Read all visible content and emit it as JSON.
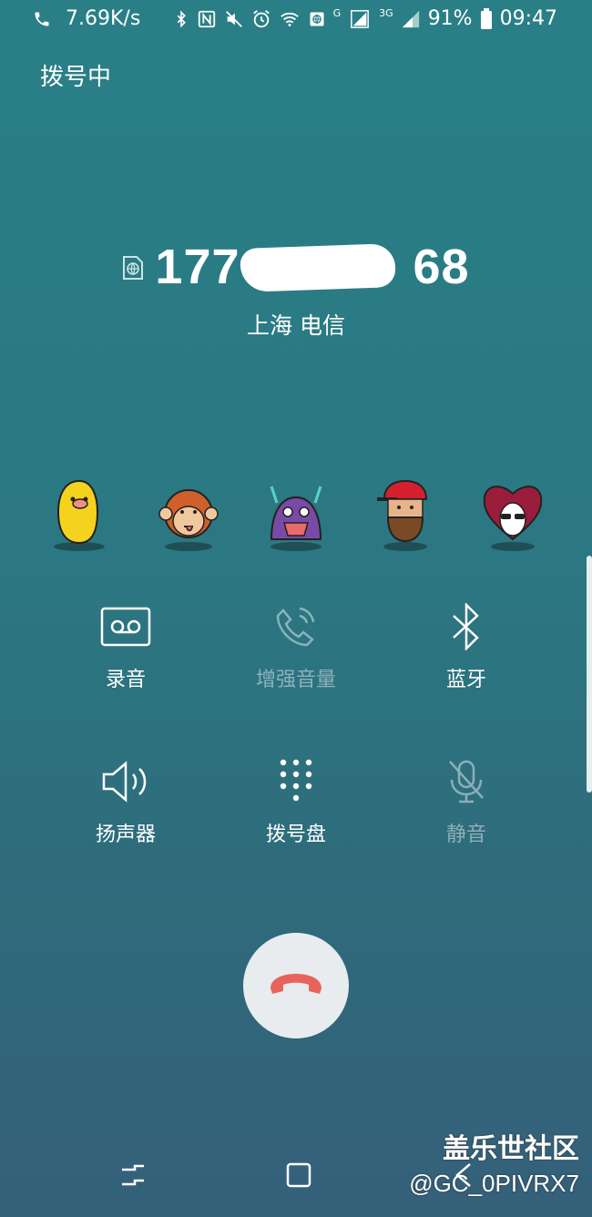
{
  "status_bar": {
    "speed": "7.69K/s",
    "g_label": "G",
    "threeg_label": "3G",
    "battery": "91%",
    "time": "09:47"
  },
  "screen_title": "拨号中",
  "caller": {
    "number_prefix": "177",
    "number_suffix": "68",
    "location": "上海 电信"
  },
  "actions": {
    "record": "录音",
    "enhance_volume": "增强音量",
    "bluetooth": "蓝牙",
    "speaker": "扬声器",
    "keypad": "拨号盘",
    "mute": "静音"
  },
  "watermark": {
    "line1": "盖乐世社区",
    "line2": "@GC_0PIVRX7"
  },
  "colors": {
    "end_call_icon": "#e8645a",
    "end_call_bg": "#e8ecee"
  }
}
